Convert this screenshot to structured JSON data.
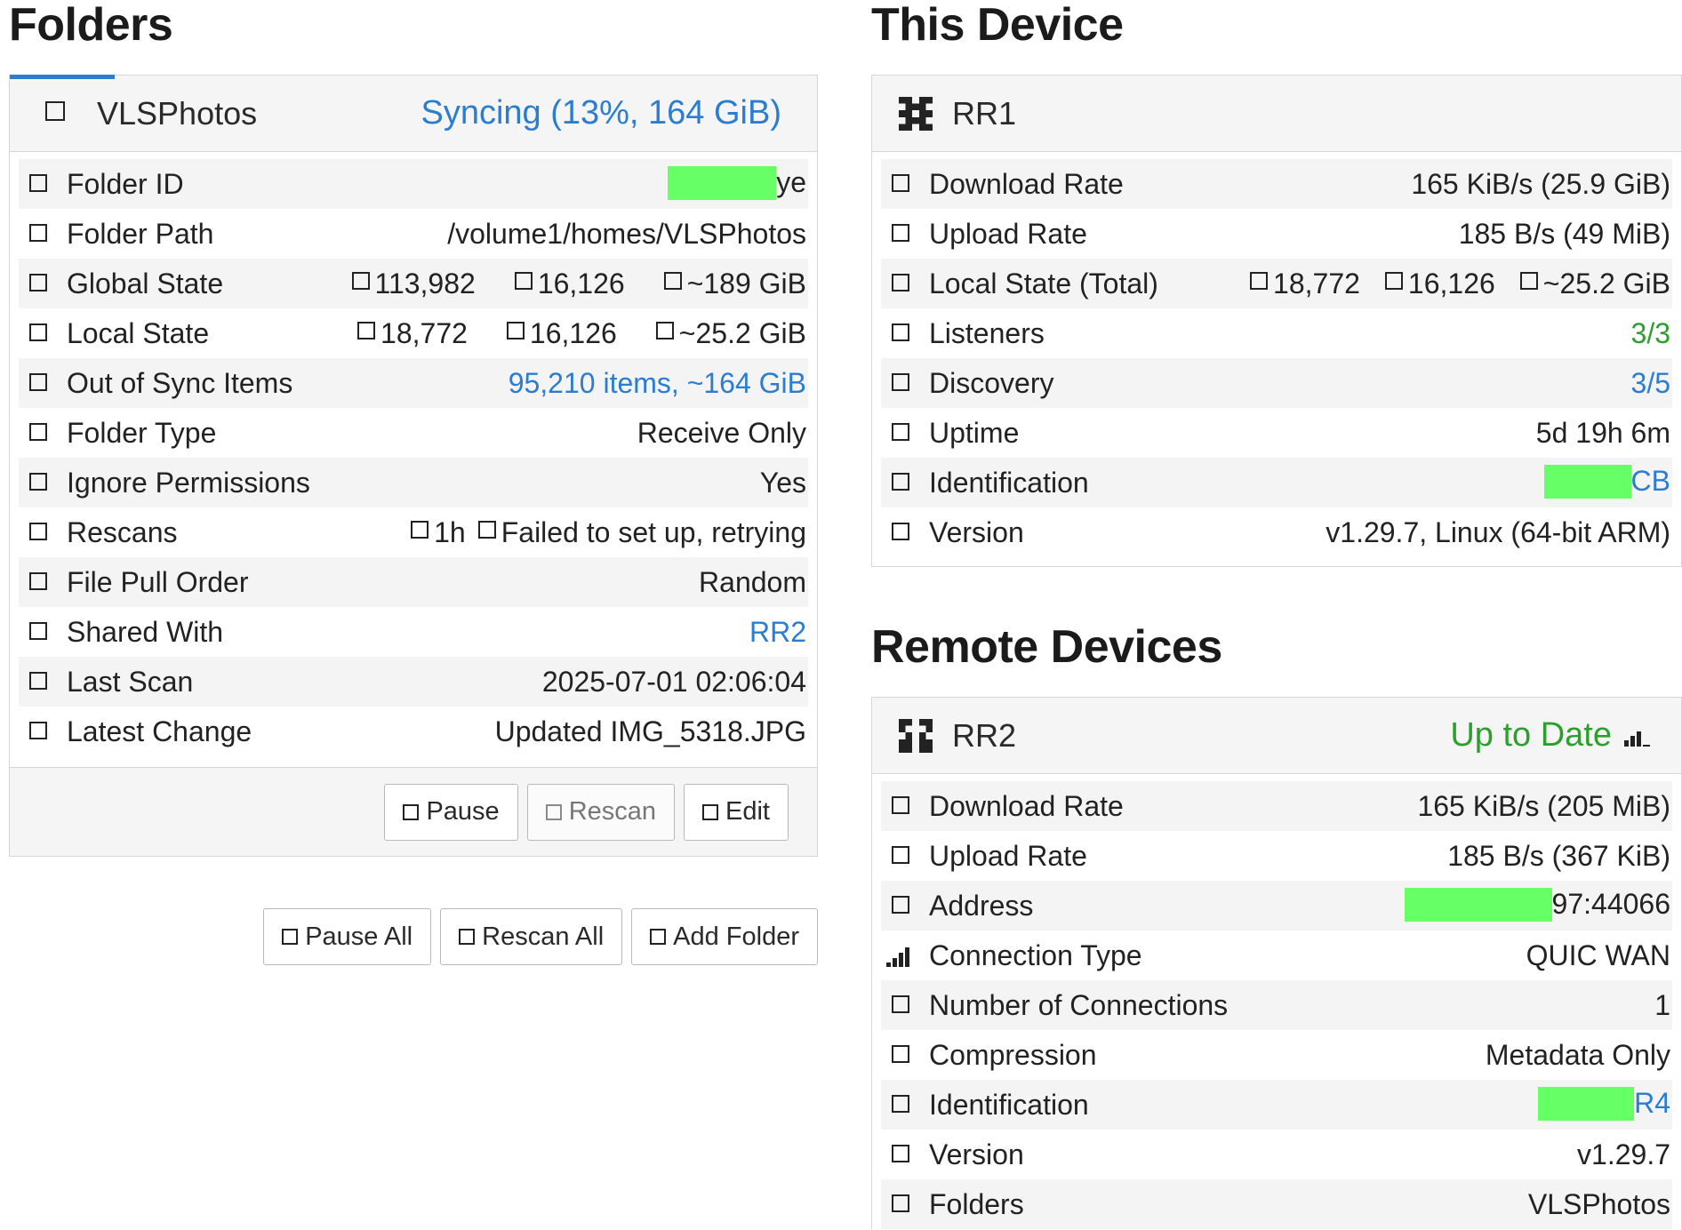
{
  "folders_section": {
    "title": "Folders",
    "folder": {
      "name": "VLSPhotos",
      "status": "Syncing (13%, 164 GiB)",
      "sync_progress_pct": 13,
      "rows": {
        "folder_id": {
          "label": "Folder ID",
          "value": "ye"
        },
        "folder_path": {
          "label": "Folder Path",
          "value": "/volume1/homes/VLSPhotos"
        },
        "global_state": {
          "label": "Global State",
          "files": "113,982",
          "dirs": "16,126",
          "size": "~189 GiB"
        },
        "local_state": {
          "label": "Local State",
          "files": "18,772",
          "dirs": "16,126",
          "size": "~25.2 GiB"
        },
        "out_of_sync": {
          "label": "Out of Sync Items",
          "value": "95,210 items, ~164 GiB"
        },
        "folder_type": {
          "label": "Folder Type",
          "value": "Receive Only"
        },
        "ignore_permissions": {
          "label": "Ignore Permissions",
          "value": "Yes"
        },
        "rescans": {
          "label": "Rescans",
          "interval": "1h",
          "watcher": "Failed to set up, retrying"
        },
        "file_pull_order": {
          "label": "File Pull Order",
          "value": "Random"
        },
        "shared_with": {
          "label": "Shared With",
          "value": "RR2"
        },
        "last_scan": {
          "label": "Last Scan",
          "value": "2025-07-01 02:06:04"
        },
        "latest_change": {
          "label": "Latest Change",
          "value": "Updated IMG_5318.JPG"
        }
      },
      "buttons": {
        "pause": "Pause",
        "rescan": "Rescan",
        "edit": "Edit"
      }
    },
    "global_buttons": {
      "pause_all": "Pause All",
      "rescan_all": "Rescan All",
      "add_folder": "Add Folder"
    }
  },
  "this_device_section": {
    "title": "This Device",
    "device": {
      "name": "RR1",
      "rows": {
        "download_rate": {
          "label": "Download Rate",
          "value": "165 KiB/s (25.9 GiB)"
        },
        "upload_rate": {
          "label": "Upload Rate",
          "value": "185 B/s (49 MiB)"
        },
        "local_state_total": {
          "label": "Local State (Total)",
          "files": "18,772",
          "dirs": "16,126",
          "size": "~25.2 GiB"
        },
        "listeners": {
          "label": "Listeners",
          "value": "3/3"
        },
        "discovery": {
          "label": "Discovery",
          "value": "3/5"
        },
        "uptime": {
          "label": "Uptime",
          "value": "5d 19h 6m"
        },
        "identification": {
          "label": "Identification",
          "value": "CB"
        },
        "version": {
          "label": "Version",
          "value": "v1.29.7, Linux (64-bit ARM)"
        }
      }
    }
  },
  "remote_devices_section": {
    "title": "Remote Devices",
    "device": {
      "name": "RR2",
      "status": "Up to Date",
      "rows": {
        "download_rate": {
          "label": "Download Rate",
          "value": "165 KiB/s (205 MiB)"
        },
        "upload_rate": {
          "label": "Upload Rate",
          "value": "185 B/s (367 KiB)"
        },
        "address": {
          "label": "Address",
          "value": "97:44066"
        },
        "connection_type": {
          "label": "Connection Type",
          "value": "QUIC WAN"
        },
        "connections": {
          "label": "Number of Connections",
          "value": "1"
        },
        "compression": {
          "label": "Compression",
          "value": "Metadata Only"
        },
        "identification": {
          "label": "Identification",
          "value": "R4"
        },
        "version": {
          "label": "Version",
          "value": "v1.29.7"
        },
        "folders": {
          "label": "Folders",
          "value": "VLSPhotos"
        }
      }
    }
  },
  "colors": {
    "link_blue": "#2a7dd1",
    "ok_green": "#2ca02c",
    "redaction_green": "#66ff66",
    "panel_heading_bg": "#f5f5f5"
  },
  "icons": {
    "placeholder_glyph": "square-icon",
    "this_device": "identicon-rr1",
    "remote_device": "identicon-rr2",
    "connection_quality": "signal-bars-icon"
  }
}
